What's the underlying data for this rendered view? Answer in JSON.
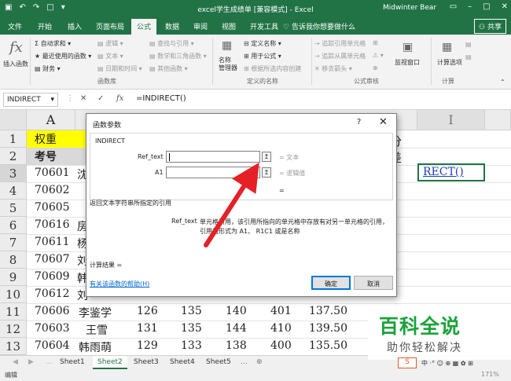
{
  "titlebar": {
    "title": "excel学生成绩单 [兼容模式] - Excel",
    "user": "Midwinter Bear",
    "qat_icons": [
      "save-icon",
      "undo-icon",
      "redo-icon",
      "new-file-icon",
      "customize-icon"
    ],
    "window_buttons": [
      "minimize-icon",
      "maximize-icon",
      "close-icon"
    ]
  },
  "ribbon_tabs": [
    "文件",
    "开始",
    "插入",
    "页面布局",
    "公式",
    "数据",
    "审阅",
    "视图",
    "开发工具",
    "告诉我你想要做什么"
  ],
  "active_tab": "公式",
  "share_label": "共享",
  "ribbon": {
    "insert_function": "插入函数",
    "library": [
      "自动求和",
      "最近使用的函数",
      "财务",
      "逻辑",
      "文本",
      "日期和时间",
      "查找与引用",
      "数学和三角函数",
      "其他函数"
    ],
    "library_group": "函数库",
    "name_manager": "名称\n管理器",
    "names": [
      "定义名称",
      "用于公式",
      "根据所选内容创建"
    ],
    "names_group": "定义的名称",
    "audit": [
      "追踪引用单元格",
      "追踪从属单元格",
      "移去箭头"
    ],
    "audit_group": "公式审核",
    "watch_window": "监视窗口",
    "calc_options": "计算选项",
    "calc_group": "计算"
  },
  "formula_bar": {
    "name_box": "INDIRECT",
    "formula": "=INDIRECT()",
    "fx": "fx"
  },
  "sheet": {
    "col_a": "A",
    "col_last": "I",
    "row_numbers": [
      "1",
      "2",
      "3",
      "4",
      "5",
      "6",
      "7",
      "8",
      "9",
      "10",
      "11",
      "12",
      "13"
    ],
    "a1": "权重",
    "a2": "考号",
    "ids": [
      "70601",
      "70602",
      "70605",
      "70616",
      "70611",
      "70607",
      "70609",
      "70612",
      "70606",
      "70603",
      "70604"
    ],
    "name_stubs": [
      "沈",
      "",
      "",
      "房",
      "杨",
      "刘",
      "韩",
      "刘"
    ],
    "right_hdr_1": "分",
    "right_hdr_2": "差",
    "active_cell": "RECT()",
    "rows": [
      {
        "name": "李鉴学",
        "v1": "126",
        "v2": "135",
        "v3": "140",
        "v4": "401",
        "v5": "137.50"
      },
      {
        "name": "王雪",
        "v1": "131",
        "v2": "135",
        "v3": "144",
        "v4": "410",
        "v5": "139.50"
      },
      {
        "name": "韩雨萌",
        "v1": "129",
        "v2": "133",
        "v3": "138",
        "v4": "400",
        "v5": "135.50"
      }
    ]
  },
  "sheet_tabs": [
    "Sheet1",
    "Sheet2",
    "Sheet3",
    "Sheet4",
    "Sheet5"
  ],
  "active_sheet": "Sheet2",
  "status": {
    "mode": "编辑",
    "zoom": "171%"
  },
  "dialog": {
    "title": "函数参数",
    "help_glyph": "?",
    "close_glyph": "✕",
    "function_name": "INDIRECT",
    "arg1_label": "Ref_text",
    "arg1_result": "= 文本",
    "arg2_label": "A1",
    "arg2_result": "= 逻辑值",
    "overall_eq": "=",
    "description": "返回文本字符串所指定的引用",
    "param_name": "Ref_text",
    "param_desc_1": "单元格引用，该引用所指向的单元格中存放有对另一单元格的引用，",
    "param_desc_2": "引用的形式为 A1、 R1C1 或是名称",
    "result_label": "计算结果 =",
    "help_link": "有关该函数的帮助(H)",
    "ok": "确定",
    "cancel": "取消"
  },
  "watermark": {
    "big": "百科全说",
    "small": "助你轻松解决"
  },
  "annotation_color": "#e52027"
}
